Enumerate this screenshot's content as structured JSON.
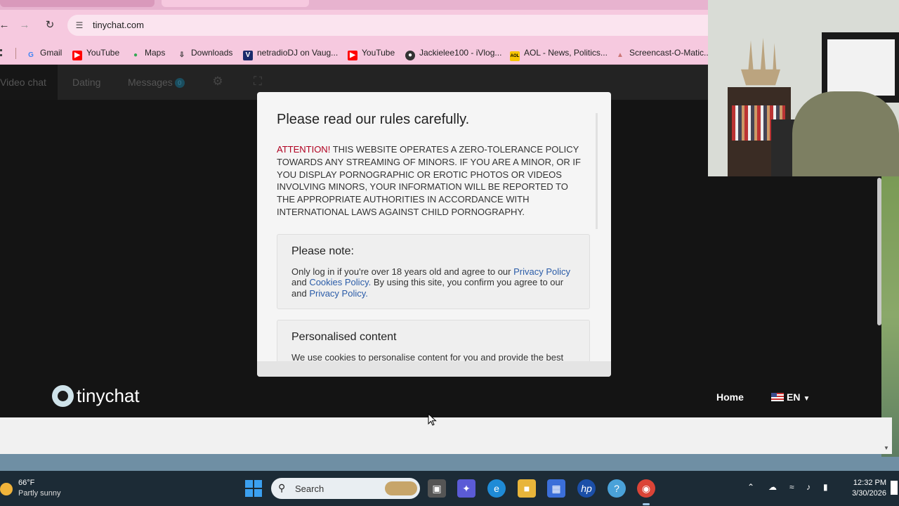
{
  "browser": {
    "url": "tinychat.com",
    "bookmarks": [
      {
        "label": "Gmail",
        "icon": "google-icon",
        "color": "#4285f4"
      },
      {
        "label": "YouTube",
        "icon": "youtube-icon",
        "color": "#ff0000"
      },
      {
        "label": "Maps",
        "icon": "maps-icon",
        "color": "#34a853"
      },
      {
        "label": "Downloads",
        "icon": "download-icon",
        "color": "#333333"
      },
      {
        "label": "netradioDJ on Vaug...",
        "icon": "vaughn-icon",
        "color": "#1b2a6b"
      },
      {
        "label": "YouTube",
        "icon": "youtube-icon",
        "color": "#ff0000"
      },
      {
        "label": "Jackielee100 - iVlog...",
        "icon": "ivlog-icon",
        "color": "#333333"
      },
      {
        "label": "AOL - News, Politics...",
        "icon": "aol-icon",
        "color": "#f5c400"
      },
      {
        "label": "Screencast-O-Matic...",
        "icon": "screencast-icon",
        "color": "#c77"
      }
    ]
  },
  "site": {
    "nav": {
      "video_chat": "Video chat",
      "dating": "Dating",
      "messages": "Messages",
      "messages_badge": "0"
    },
    "brand": "tinychat",
    "footer": {
      "home": "Home",
      "language": "EN"
    }
  },
  "modal": {
    "title": "Please read our rules carefully.",
    "attention_label": "ATTENTION!",
    "attention_text": " THIS WEBSITE OPERATES A ZERO-TOLERANCE POLICY TOWARDS ANY STREAMING OF MINORS. IF YOU ARE A MINOR, OR IF YOU DISPLAY PORNOGRAPHIC OR EROTIC PHOTOS OR VIDEOS INVOLVING MINORS, YOUR INFORMATION WILL BE REPORTED TO THE APPROPRIATE AUTHORITIES IN ACCORDANCE WITH INTERNATIONAL LAWS AGAINST CHILD PORNOGRAPHY.",
    "note": {
      "heading": "Please note:",
      "text_1": "Only log in if you're over 18 years old and agree to our ",
      "link_privacy": "Privacy Policy",
      "text_2": " and ",
      "link_cookies": "Cookies Policy.",
      "text_3": " By using this site, you confirm you agree to our and ",
      "link_privacy_2": "Privacy Policy."
    },
    "personalised": {
      "heading": "Personalised content",
      "text": "We use cookies to personalise content for you and provide the best"
    }
  },
  "taskbar": {
    "weather_temp": "66°F",
    "weather_cond": "Partly sunny",
    "search_placeholder": "Search",
    "time": "12:32 PM",
    "date": "3/30/2026"
  },
  "colors": {
    "attention": "#b00020",
    "link": "#2b5ca8",
    "browser_theme": "#f6c9df"
  }
}
